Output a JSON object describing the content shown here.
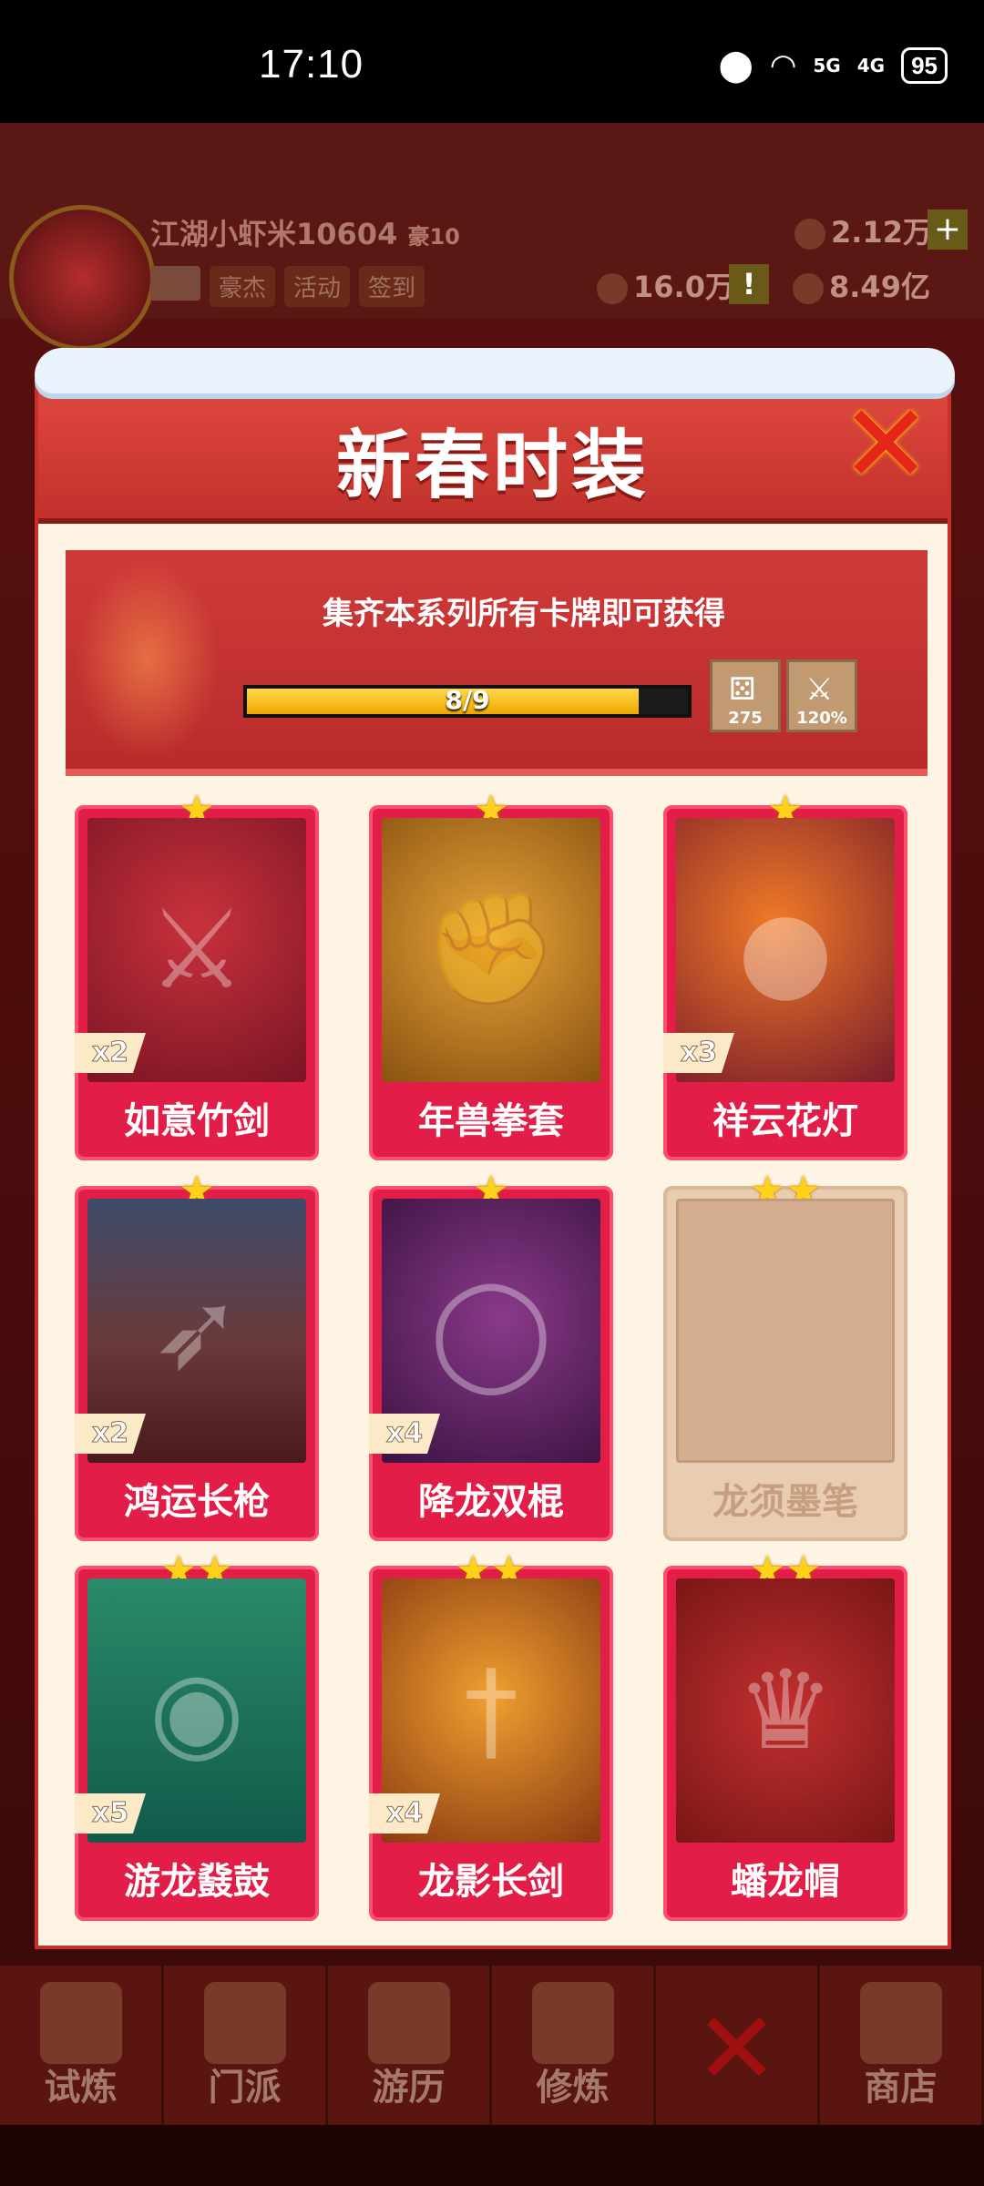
{
  "status_bar": {
    "time": "17:10",
    "network_5g": "5G",
    "network_4g": "4G",
    "battery": "95"
  },
  "game_header": {
    "player_name": "江湖小虾米10604",
    "vip": "豪10",
    "buttons": [
      "豪杰",
      "活动",
      "签到"
    ],
    "gems": "2.12万",
    "power": "16.0万",
    "coins": "8.49亿"
  },
  "modal": {
    "title": "新春时装",
    "banner_text": "集齐本系列所有卡牌即可获得",
    "progress": {
      "label": "8/9",
      "fraction": 0.889
    },
    "rewards": [
      {
        "icon": "dice-icon",
        "value": "275"
      },
      {
        "icon": "sword-icon",
        "value": "120%"
      }
    ],
    "cards": [
      {
        "name": "如意竹剑",
        "stars": "★",
        "count": "x2",
        "locked": false
      },
      {
        "name": "年兽拳套",
        "stars": "★",
        "count": "",
        "locked": false
      },
      {
        "name": "祥云花灯",
        "stars": "★",
        "count": "x3",
        "locked": false
      },
      {
        "name": "鸿运长枪",
        "stars": "★",
        "count": "x2",
        "locked": false
      },
      {
        "name": "降龙双棍",
        "stars": "★",
        "count": "x4",
        "locked": false
      },
      {
        "name": "龙须墨笔",
        "stars": "★★",
        "count": "",
        "locked": true
      },
      {
        "name": "游龙鼗鼓",
        "stars": "★★",
        "count": "x5",
        "locked": false
      },
      {
        "name": "龙影长剑",
        "stars": "★★",
        "count": "x4",
        "locked": false
      },
      {
        "name": "蟠龙帽",
        "stars": "★★",
        "count": "",
        "locked": false
      }
    ]
  },
  "bottom_nav": [
    "试炼",
    "门派",
    "游历",
    "修炼",
    "",
    "商店"
  ]
}
